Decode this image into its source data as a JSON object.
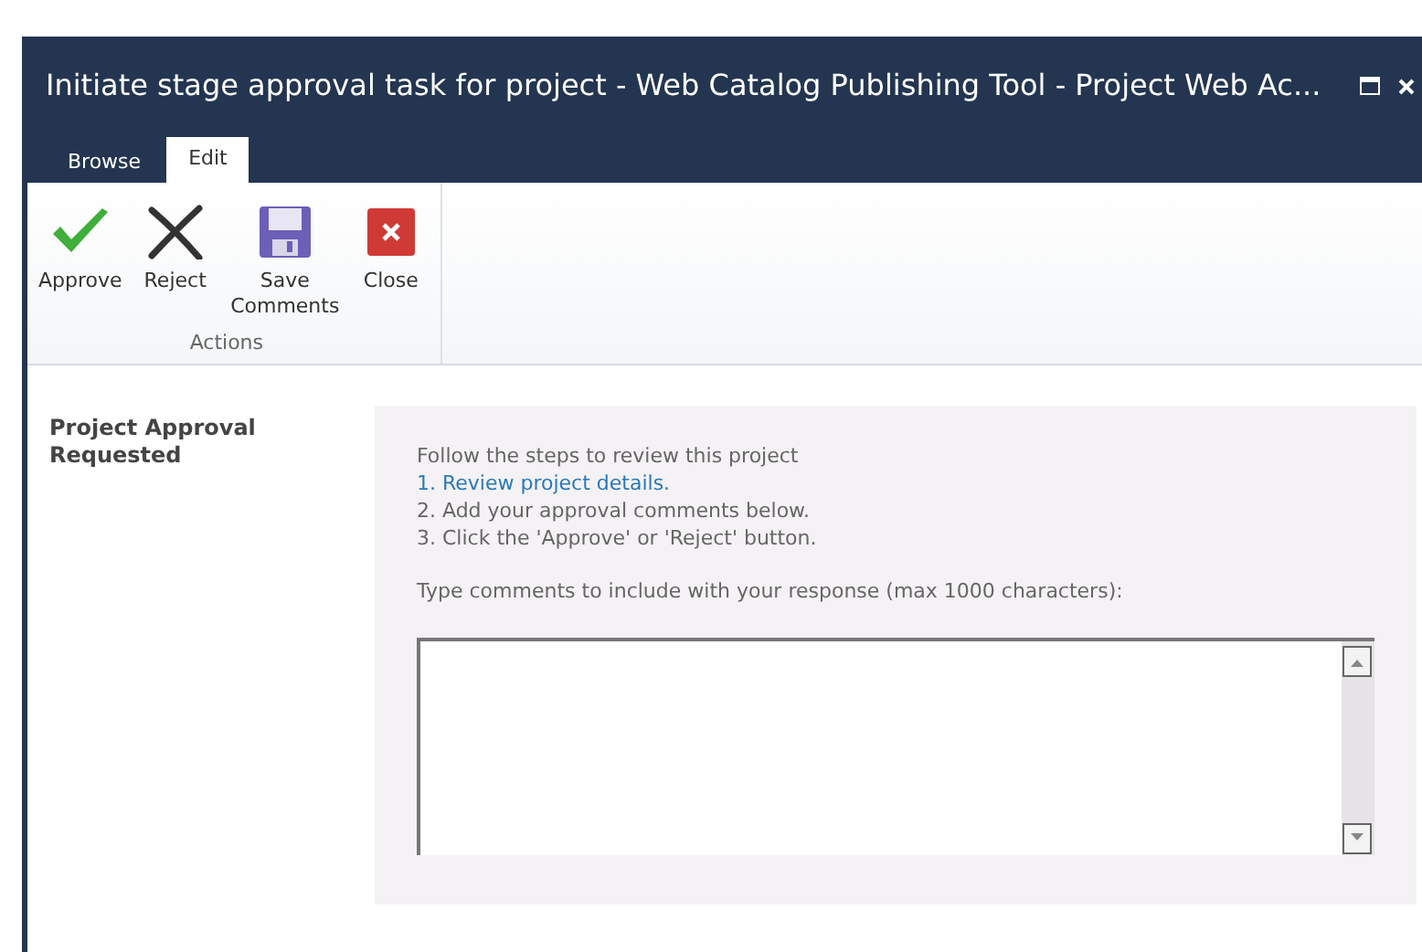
{
  "window": {
    "title": "Initiate stage approval task for project - Web Catalog Publishing Tool - Project Web Ac..."
  },
  "tabs": [
    {
      "label": "Browse",
      "selected": false
    },
    {
      "label": "Edit",
      "selected": true
    }
  ],
  "ribbon": {
    "buttons": [
      {
        "kind": "approve",
        "label": "Approve"
      },
      {
        "kind": "reject",
        "label": "Reject"
      },
      {
        "kind": "save",
        "label": "Save Comments"
      },
      {
        "kind": "close",
        "label": "Close"
      }
    ],
    "group": "Actions"
  },
  "section_label": "Project Approval Requested",
  "instructions": {
    "intro": "Follow the steps to review this project",
    "steps": [
      {
        "kind": "link",
        "text": "1. Review project details."
      },
      {
        "kind": "text",
        "text": "2. Add your approval comments below."
      },
      {
        "kind": "text",
        "text": "3. Click the 'Approve' or 'Reject' button."
      }
    ]
  },
  "comments": {
    "label": "Type comments to include with your response (max 1000 characters):"
  }
}
